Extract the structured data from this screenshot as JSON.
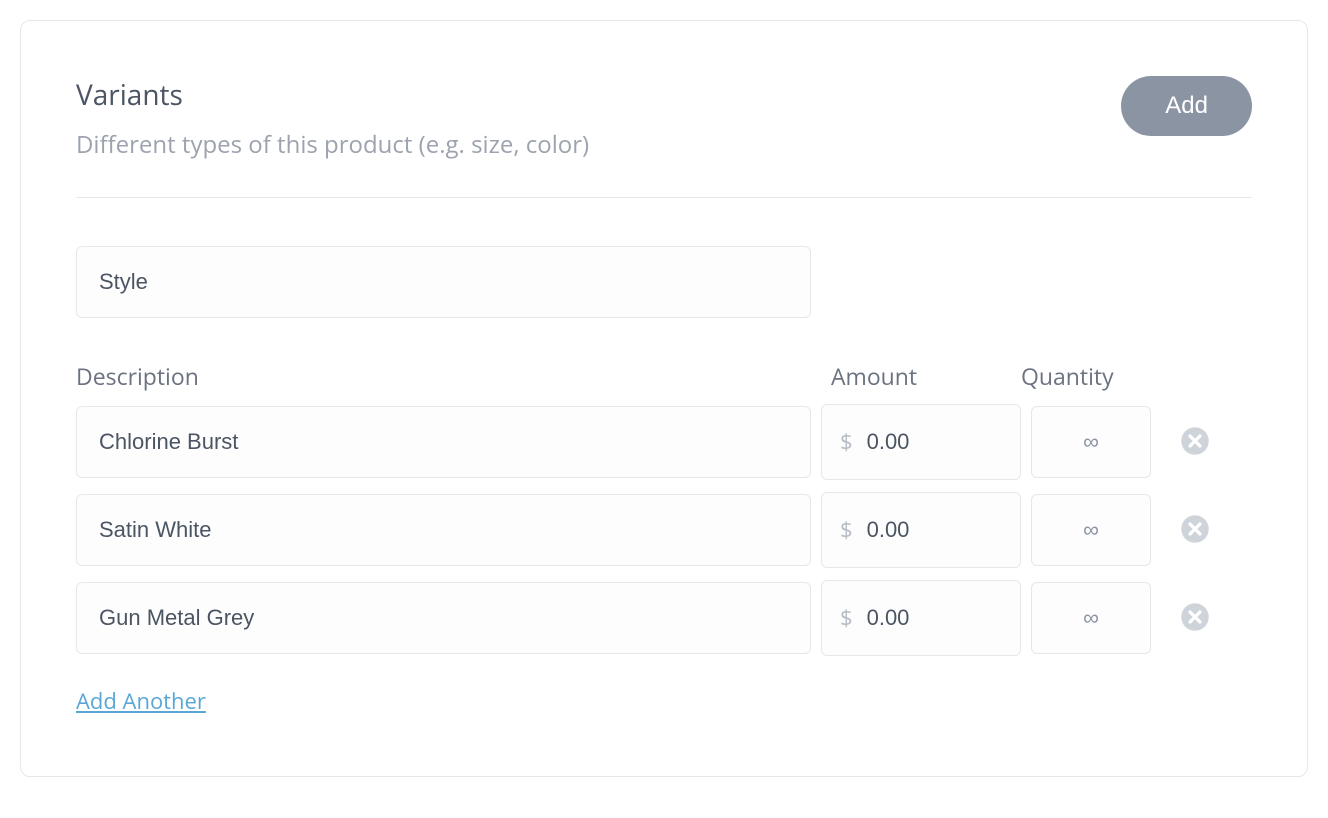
{
  "header": {
    "title": "Variants",
    "subtitle": "Different types of this product (e.g. size, color)",
    "add_label": "Add"
  },
  "group": {
    "name": "Style"
  },
  "columns": {
    "description": "Description",
    "amount": "Amount",
    "quantity": "Quantity"
  },
  "currency_symbol": "$",
  "rows": [
    {
      "description": "Chlorine Burst",
      "amount": "0.00",
      "quantity": "∞"
    },
    {
      "description": "Satin White",
      "amount": "0.00",
      "quantity": "∞"
    },
    {
      "description": "Gun Metal Grey",
      "amount": "0.00",
      "quantity": "∞"
    }
  ],
  "add_another_label": "Add Another"
}
